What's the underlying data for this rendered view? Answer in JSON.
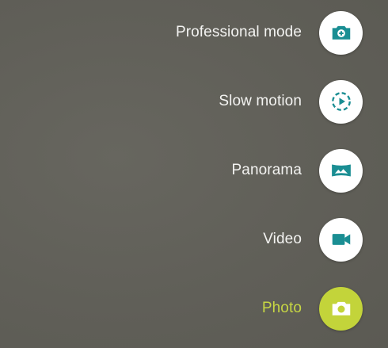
{
  "colors": {
    "background": "#62615a",
    "label": "#f3f3f1",
    "icon_teal": "#1a8e93",
    "active_accent": "#c7d743",
    "active_button": "#c3d43a",
    "button_bg": "#ffffff"
  },
  "modes": [
    {
      "label": "Professional mode",
      "icon": "pro-camera-icon",
      "active": false
    },
    {
      "label": "Slow motion",
      "icon": "slow-motion-icon",
      "active": false
    },
    {
      "label": "Panorama",
      "icon": "panorama-icon",
      "active": false
    },
    {
      "label": "Video",
      "icon": "video-camera-icon",
      "active": false
    },
    {
      "label": "Photo",
      "icon": "photo-camera-icon",
      "active": true
    }
  ]
}
